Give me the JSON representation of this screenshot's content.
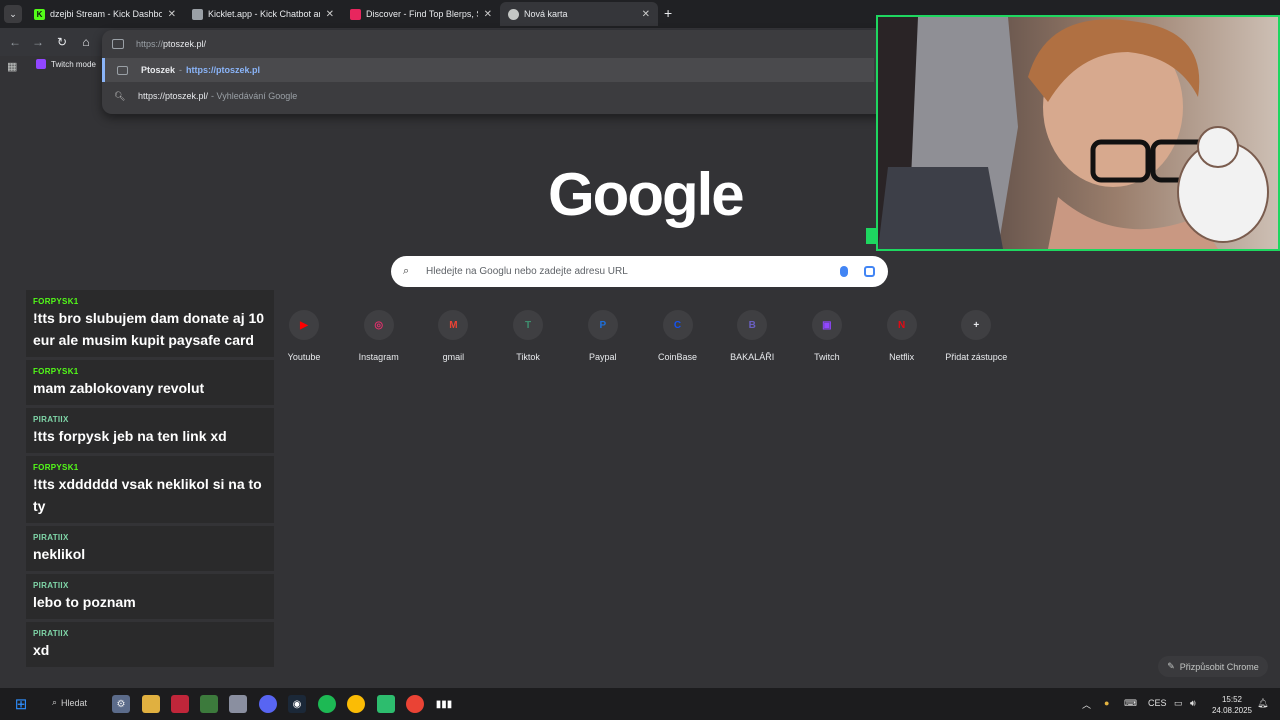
{
  "tabs": [
    {
      "title": "dzejbi Stream - Kick Dashboard",
      "favicon": "kick-icon",
      "color": "#53fc18"
    },
    {
      "title": "Kicklet.app - Kick Chatbot and (",
      "favicon": "kicklet-icon",
      "color": "#9aa0a6"
    },
    {
      "title": "Discover - Find Top Blerps, Stre",
      "favicon": "blerp-icon",
      "color": "#e8265e"
    },
    {
      "title": "Nová karta",
      "favicon": "chrome-icon",
      "color": "#c4c7c5",
      "active": true
    }
  ],
  "omnibox": {
    "input_prefix": "https://",
    "input_rest": "ptoszek.pl/",
    "suggestions": [
      {
        "title": "Ptoszek",
        "separator": "-",
        "url": "https://ptoszek.pl"
      },
      {
        "query": "https://ptoszek.pl/",
        "suffix": "- Vyhledávání Google"
      }
    ]
  },
  "bookmarks": {
    "twitch": "Twitch mode"
  },
  "google": {
    "logo": "Google",
    "placeholder": "Hledejte na Googlu nebo zadejte adresu URL"
  },
  "shortcuts": [
    {
      "label": "Youtube",
      "icon": "youtube-icon",
      "glyph": "▶",
      "color": "#ff0000"
    },
    {
      "label": "Instagram",
      "icon": "instagram-icon",
      "glyph": "◎",
      "color": "#e1306c"
    },
    {
      "label": "gmail",
      "icon": "gmail-icon",
      "glyph": "M",
      "color": "#ea4335"
    },
    {
      "label": "Tiktok",
      "icon": "tiktok-icon",
      "glyph": "T",
      "color": "#3f8f6f"
    },
    {
      "label": "Paypal",
      "icon": "paypal-icon",
      "glyph": "P",
      "color": "#1e6fd9"
    },
    {
      "label": "CoinBase",
      "icon": "coinbase-icon",
      "glyph": "C",
      "color": "#1652f0"
    },
    {
      "label": "BAKALÁŘI",
      "icon": "bakalari-icon",
      "glyph": "B",
      "color": "#6a5fc1"
    },
    {
      "label": "Twitch",
      "icon": "twitch-icon",
      "glyph": "▣",
      "color": "#9146ff"
    },
    {
      "label": "Netflix",
      "icon": "netflix-icon",
      "glyph": "N",
      "color": "#e50914"
    },
    {
      "label": "Přidat zástupce",
      "icon": "plus-icon",
      "glyph": "+",
      "color": "#e8eaed"
    }
  ],
  "customize_label": "Přizpůsobit Chrome",
  "chat": [
    {
      "user": "FORPYSK1",
      "text": "!tts bro slubujem dam donate aj 10 eur ale musim kupit paysafe card",
      "color": "#53fc18"
    },
    {
      "user": "FORPYSK1",
      "text": "mam zablokovany revolut",
      "color": "#53fc18"
    },
    {
      "user": "PIRATIIX",
      "text": "!tts forpysk jeb na ten link xd",
      "color": "#7fd6a8"
    },
    {
      "user": "FORPYSK1",
      "text": "!tts xdddddd vsak neklikol si na to ty",
      "color": "#53fc18"
    },
    {
      "user": "PIRATIIX",
      "text": "neklikol",
      "color": "#7fd6a8"
    },
    {
      "user": "PIRATIIX",
      "text": "lebo to poznam",
      "color": "#7fd6a8"
    },
    {
      "user": "PIRATIIX",
      "text": "xd",
      "color": "#7fd6a8"
    }
  ],
  "taskbar": {
    "search_label": "Hledat",
    "language": "CES",
    "time": "15:52",
    "date": "24.08.2025"
  },
  "colors": {
    "cam_border": "#1ed760",
    "accent": "#8ab4f8"
  }
}
